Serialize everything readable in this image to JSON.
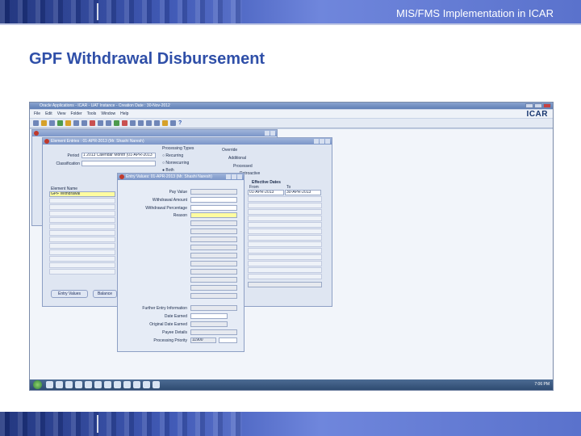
{
  "slide": {
    "header_title": "MIS/FMS Implementation in ICAR",
    "title": "GPF Withdrawal Disbursement"
  },
  "app": {
    "window_title": "Oracle Applications - ICAR - UAT Instance - Creation Date : 30-Nov-2012",
    "menu": [
      "File",
      "Edit",
      "View",
      "Folder",
      "Tools",
      "Window",
      "Help"
    ],
    "logo": "ICAR",
    "help_glyph": "?"
  },
  "element_entries": {
    "title": "Element Entries : 01-APR-2013 (Mr. Shashi Naresh)",
    "period_label": "Period",
    "period_value": "1 2013 Calendar Month (01-APR-2013",
    "classification_label": "Classification",
    "processing_types_label": "Processing Types",
    "recurring": "Recurring",
    "nonrecurring": "Nonrecurring",
    "both": "Both",
    "override": "Override",
    "additional": "Additional",
    "processed": "Processed",
    "retroactive": "Retroactive",
    "effective_dates": "Effective Dates",
    "from_label": "From",
    "to_label": "To",
    "from_value": "01-APR-2013",
    "to_value": "30-APR-2013",
    "element_name_label": "Element Name",
    "element_value": "GPF Withdrawal",
    "entry_values_button": "Entry Values",
    "balance_button": "Balance"
  },
  "entry_values": {
    "title": "Entry Values: 01-APR-2013 (Mr. Shashi Naresh)",
    "pay_value": "Pay Value",
    "withdrawal_amount": "Withdrawal Amount",
    "withdrawal_percentage": "Withdrawal Percentage",
    "reason": "Reason",
    "further_entry": "Further Entry Information",
    "date_earned": "Date Earned",
    "original_date_earned": "Original Date Earned",
    "payee_details": "Payee Details",
    "processing_priority": "Processing Priority",
    "priority_value": "11900"
  },
  "taskbar": {
    "clock": "7:06 PM"
  },
  "colors": {
    "accent": "#2f4fa8",
    "band": "#3a54b4",
    "highlight": "#fffca0"
  }
}
